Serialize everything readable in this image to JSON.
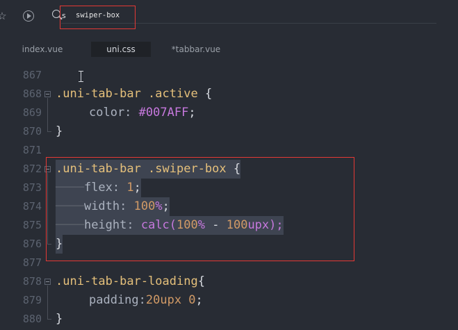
{
  "search": {
    "prefix": "s",
    "value": "swiper-box"
  },
  "tabs": [
    {
      "label": "index.vue",
      "active": false
    },
    {
      "label": "uni.css",
      "active": true
    },
    {
      "label": "*tabbar.vue",
      "active": false
    }
  ],
  "lines": [
    {
      "num": "867"
    },
    {
      "num": "868"
    },
    {
      "num": "869"
    },
    {
      "num": "870"
    },
    {
      "num": "871"
    },
    {
      "num": "872"
    },
    {
      "num": "873"
    },
    {
      "num": "874"
    },
    {
      "num": "875"
    },
    {
      "num": "876"
    },
    {
      "num": "877"
    },
    {
      "num": "878"
    },
    {
      "num": "879"
    },
    {
      "num": "880"
    }
  ],
  "code": {
    "l868_sel": ".uni-tab-bar .active",
    "l868_brace": " {",
    "l869_prop": "color: ",
    "l869_val": "#007AFF",
    "l869_semi": ";",
    "l870": "}",
    "l872_sel": ".uni-tab-bar .swiper-box",
    "l872_brace": " {",
    "l873_prop": "flex: ",
    "l873_val": "1",
    "l873_semi": ";",
    "l874_prop": "width: ",
    "l874_val": "100",
    "l874_unit": "%",
    "l874_semi": ";",
    "l875_prop": "height: ",
    "l875_fn": "calc(",
    "l875_n1": "100",
    "l875_u1": "%",
    "l875_op": " - ",
    "l875_n2": "100",
    "l875_u2": "upx",
    "l875_end": ");",
    "l876": "}",
    "l878_sel": ".uni-tab-bar-loading",
    "l878_brace": "{",
    "l879_prop": "padding:",
    "l879_val": "20upx 0",
    "l879_semi": ";",
    "l880": "}"
  },
  "colors": {
    "selector": "#e5c07b",
    "number": "#d19a66",
    "keyword": "#c678dd",
    "highlight_box": "#e53935"
  }
}
